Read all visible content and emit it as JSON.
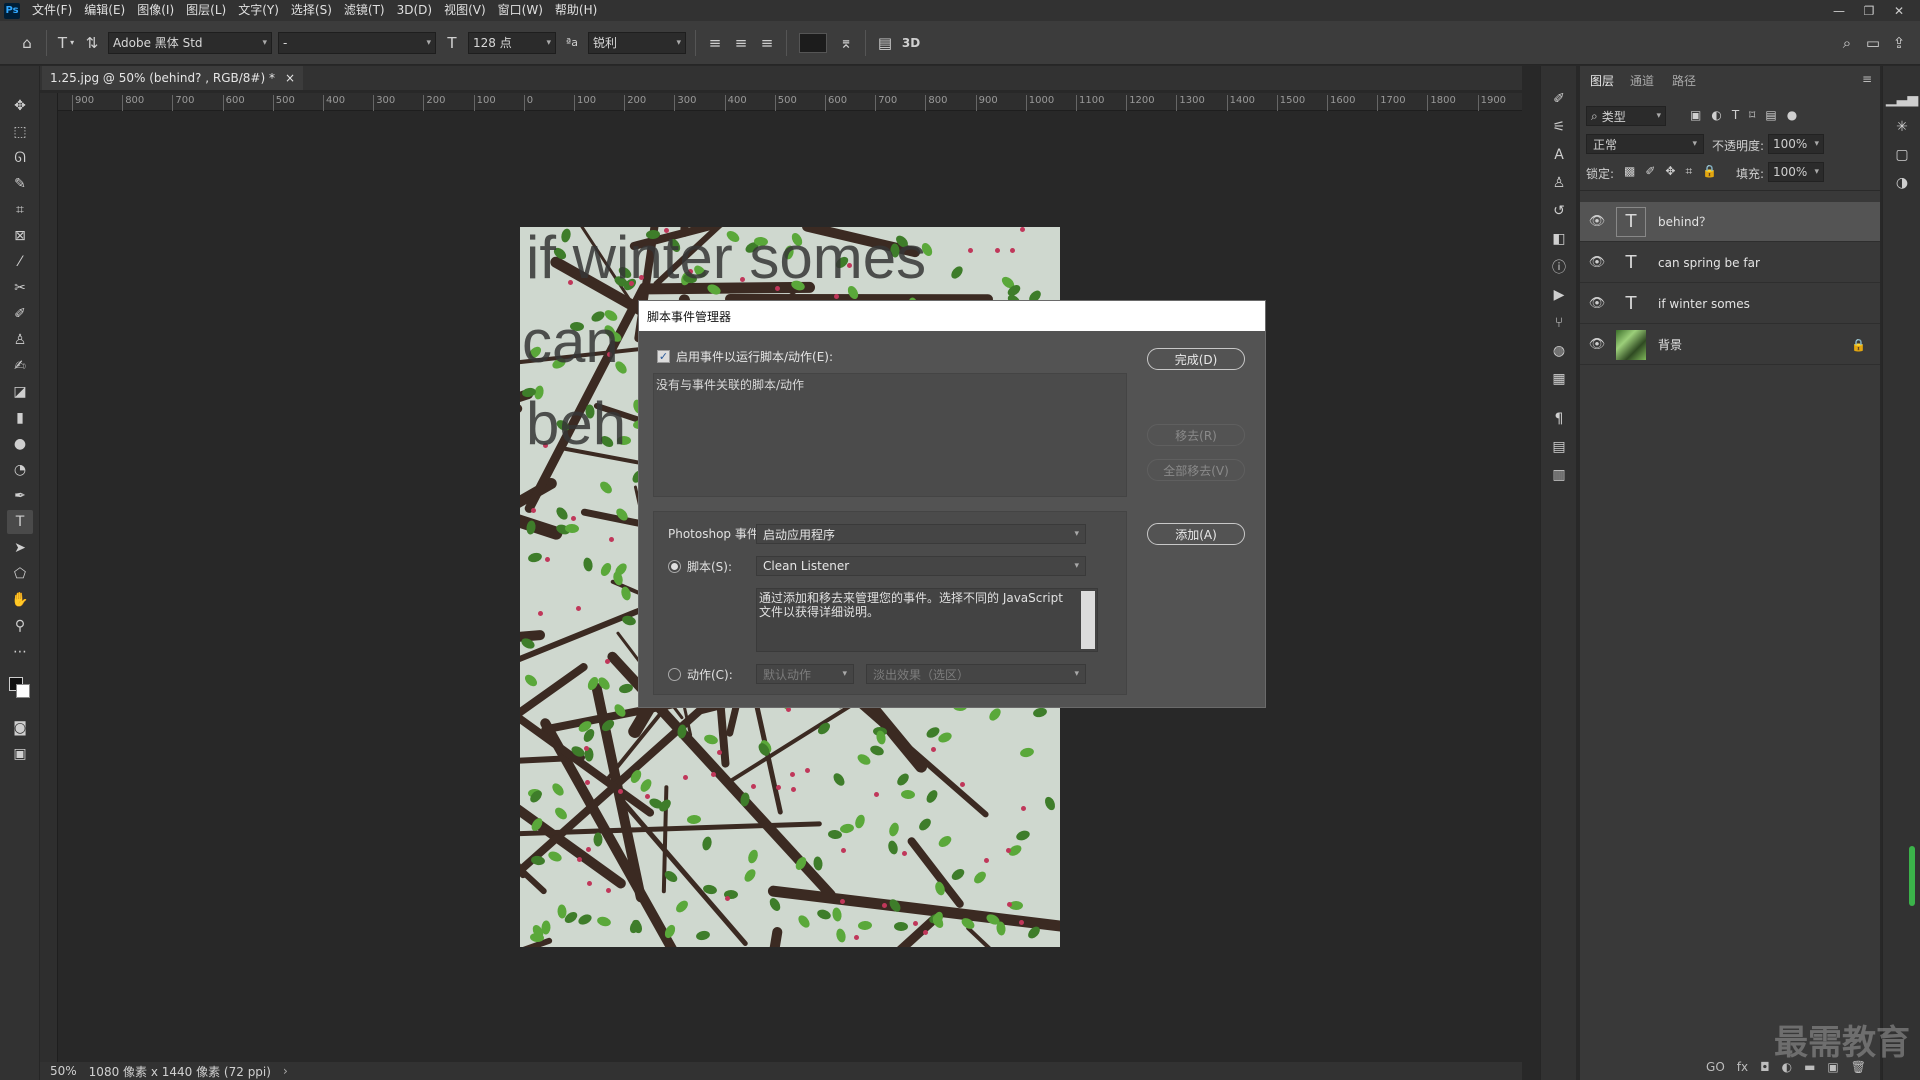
{
  "menubar": {
    "logo": "Ps",
    "items": [
      "文件(F)",
      "编辑(E)",
      "图像(I)",
      "图层(L)",
      "文字(Y)",
      "选择(S)",
      "滤镜(T)",
      "3D(D)",
      "视图(V)",
      "窗口(W)",
      "帮助(H)"
    ]
  },
  "options": {
    "font_family": "Adobe 黑体 Std",
    "font_style": "-",
    "font_size": "128 点",
    "aa_label": "ªa",
    "anti_alias": "锐利",
    "threed": "3D"
  },
  "document": {
    "tab_title": "1.25.jpg @ 50% (behind? , RGB/8#) *",
    "close": "×",
    "canvas_text": [
      "if winter somes",
      "can",
      "beh"
    ]
  },
  "ruler": {
    "ticks": [
      "900",
      "800",
      "700",
      "600",
      "500",
      "400",
      "300",
      "200",
      "100",
      "0",
      "100",
      "200",
      "300",
      "400",
      "500",
      "600",
      "700",
      "800",
      "900",
      "1000",
      "1100",
      "1200",
      "1300",
      "1400",
      "1500",
      "1600",
      "1700",
      "1800",
      "1900"
    ]
  },
  "status": {
    "zoom": "50%",
    "info": "1080 像素 x 1440 像素 (72 ppi)"
  },
  "dialog": {
    "title": "脚本事件管理器",
    "enable_label": "启用事件以运行脚本/动作(E):",
    "empty_list": "没有与事件关联的脚本/动作",
    "done": "完成(D)",
    "remove": "移去(R)",
    "remove_all": "全部移去(V)",
    "add": "添加(A)",
    "event_label": "Photoshop 事件:",
    "event_value": "启动应用程序",
    "script_label": "脚本(S):",
    "script_value": "Clean Listener",
    "description": "通过添加和移去来管理您的事件。选择不同的 JavaScript 文件以获得详细说明。",
    "action_label": "动作(C):",
    "action_set": "默认动作",
    "action_value": "淡出效果（选区）"
  },
  "layers_panel": {
    "tabs": [
      "图层",
      "通道",
      "路径"
    ],
    "filter": "类型",
    "blend_mode": "正常",
    "opacity_label": "不透明度:",
    "opacity": "100%",
    "lock_label": "锁定:",
    "fill_label": "填充:",
    "fill": "100%",
    "layers": [
      {
        "name": "behind？",
        "type": "T"
      },
      {
        "name": "can spring be far",
        "type": "T"
      },
      {
        "name": "if winter somes",
        "type": "T"
      },
      {
        "name": "背景",
        "type": "image"
      }
    ],
    "bottom_icons": [
      "GO",
      "fx",
      "◘",
      "◐",
      "▬",
      "▣",
      "🗑"
    ]
  },
  "watermark": "最需教育"
}
